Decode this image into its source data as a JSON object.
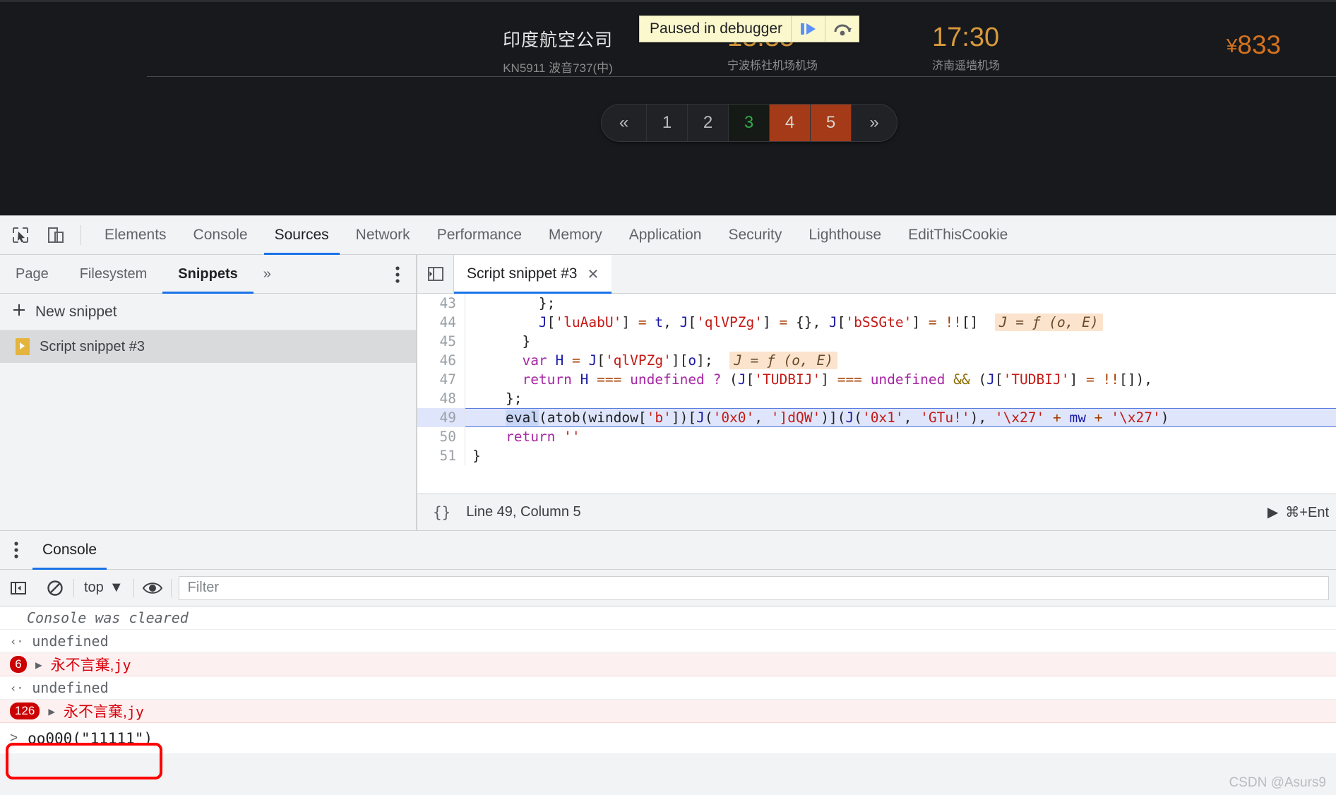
{
  "page": {
    "flight": {
      "airline": "印度航空公司",
      "aircraft": "KN5911 波音737(中)",
      "depart_time": "13:35",
      "depart_airport": "宁波栎社机场机场",
      "arrive_time": "17:30",
      "arrive_airport": "济南遥墙机场",
      "currency": "¥",
      "price": "833"
    },
    "pagination": {
      "prev": "«",
      "next": "»",
      "pages": [
        "1",
        "2",
        "3",
        "4",
        "5"
      ],
      "current": "3",
      "highlighted": [
        "4",
        "5"
      ],
      "current_color": "#31a84a",
      "highlight_color": "#a43a18"
    }
  },
  "paused_overlay": {
    "text": "Paused in debugger",
    "resume_icon": "resume-script-icon",
    "step_over_icon": "step-over-icon"
  },
  "devtools": {
    "inspect_icon": "inspect-element-icon",
    "device_icon": "device-toolbar-icon",
    "tabs": [
      {
        "label": "Elements",
        "active": false
      },
      {
        "label": "Console",
        "active": false
      },
      {
        "label": "Sources",
        "active": true
      },
      {
        "label": "Network",
        "active": false
      },
      {
        "label": "Performance",
        "active": false
      },
      {
        "label": "Memory",
        "active": false
      },
      {
        "label": "Application",
        "active": false
      },
      {
        "label": "Security",
        "active": false
      },
      {
        "label": "Lighthouse",
        "active": false
      },
      {
        "label": "EditThisCookie",
        "active": false
      }
    ]
  },
  "navigator": {
    "tabs": [
      {
        "label": "Page",
        "active": false
      },
      {
        "label": "Filesystem",
        "active": false
      },
      {
        "label": "Snippets",
        "active": true
      }
    ],
    "more_icon": "chevron-double-right-icon",
    "kebab_icon": "more-options-icon",
    "new_snippet": "New snippet",
    "plus_icon": "plus-icon",
    "items": [
      {
        "label": "Script snippet #3",
        "icon": "snippet-file-icon",
        "selected": true
      }
    ]
  },
  "editor": {
    "sidebar_toggle_icon": "show-navigator-icon",
    "tab_title": "Script snippet #3",
    "close_icon": "close-icon",
    "status": {
      "format_icon": "{}",
      "position": "Line 49, Column 5",
      "run_icon": "run-snippet-icon",
      "run_shortcut": "⌘+Ent"
    },
    "lines": [
      {
        "n": "43",
        "exec": false
      },
      {
        "n": "44",
        "exec": false
      },
      {
        "n": "45",
        "exec": false
      },
      {
        "n": "46",
        "exec": false
      },
      {
        "n": "47",
        "exec": false
      },
      {
        "n": "48",
        "exec": false
      },
      {
        "n": "49",
        "exec": true
      },
      {
        "n": "50",
        "exec": false
      },
      {
        "n": "51",
        "exec": false
      }
    ],
    "code_text": {
      "l43": "        };",
      "l44": "        J['luAabU'] = t, J['qlVPZg'] = {}, J['bSSGte'] = !![]",
      "l44_hint": "J = ƒ (o, E)",
      "l45": "    }",
      "l46": "    var H = J['qlVPZg'][o];",
      "l46_hint": "J = ƒ (o, E)",
      "l47": "    return H === undefined ? (J['TUDBIJ'] === undefined && (J['TUDBIJ'] = !![]),",
      "l48": "  };",
      "l49": "    eval(atob(window['b'])[J('0x0', ']dQW')](J('0x1', 'GTu!'), '\\x27' + mw + '\\x27')",
      "l50": "    return ''",
      "l51": "}"
    }
  },
  "drawer": {
    "kebab_icon": "more-tools-icon",
    "tab": "Console",
    "toolbar": {
      "sidebar_icon": "console-sidebar-icon",
      "clear_icon": "clear-console-icon",
      "context": "top",
      "context_caret": "▼",
      "eye_icon": "live-expression-icon",
      "filter_placeholder": "Filter"
    },
    "logs": [
      {
        "type": "cleared",
        "text": "Console was cleared"
      },
      {
        "type": "return",
        "marker": "‹·",
        "text": "undefined"
      },
      {
        "type": "error",
        "count": "6",
        "caret": "▶",
        "text": "永不言棄,",
        "mono": "jy"
      },
      {
        "type": "return",
        "marker": "‹·",
        "text": "undefined"
      },
      {
        "type": "error",
        "count": "126",
        "caret": "▶",
        "text": "永不言棄,",
        "mono": "jy"
      }
    ],
    "prompt": {
      "marker": ">",
      "value": "oo000(\"11111\")"
    }
  },
  "watermark": "CSDN @Asurs9"
}
